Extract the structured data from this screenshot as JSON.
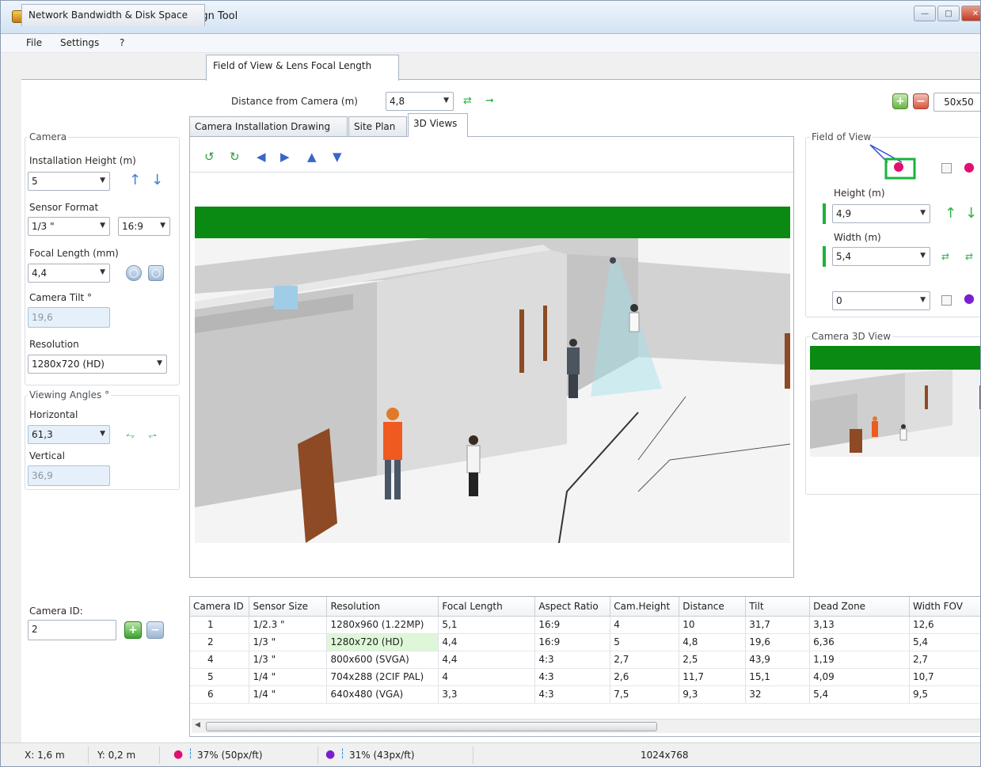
{
  "window": {
    "title": "cctv.jvsg* - IP Video System Design Tool"
  },
  "menu": [
    "File",
    "Settings",
    "?"
  ],
  "top_tabs": [
    "Network Bandwidth & Disk Space",
    "Field of View & Lens Focal Length"
  ],
  "distance": {
    "label": "Distance from Camera (m)",
    "value": "4,8"
  },
  "zoom_label": "50x50",
  "sub_tabs": [
    "Camera Installation Drawing",
    "Site Plan",
    "3D Views"
  ],
  "camera": {
    "group_label": "Camera",
    "installation_height_label": "Installation Height (m)",
    "installation_height": "5",
    "sensor_format_label": "Sensor Format",
    "sensor_format": "1/3 \"",
    "aspect": "16:9",
    "focal_length_label": "Focal Length (mm)",
    "focal_length": "4,4",
    "tilt_label": "Camera Tilt °",
    "tilt": "19,6",
    "resolution_label": "Resolution",
    "resolution": "1280x720 (HD)"
  },
  "viewing_angles": {
    "group_label": "Viewing Angles °",
    "horizontal_label": "Horizontal",
    "horizontal": "61,3",
    "vertical_label": "Vertical",
    "vertical": "36,9"
  },
  "field_of_view": {
    "group_label": "Field of View",
    "height_label": "Height (m)",
    "height": "4,9",
    "width_label": "Width (m)",
    "width": "5,4",
    "offset": "0"
  },
  "camera_3d_label": "Camera 3D View",
  "camera_id": {
    "label": "Camera ID:",
    "value": "2"
  },
  "table": {
    "columns": [
      "Camera ID",
      "Sensor Size",
      "Resolution",
      "Focal Length",
      "Aspect Ratio",
      "Cam.Height",
      "Distance",
      "Tilt",
      "Dead Zone",
      "Width FOV"
    ],
    "rows": [
      [
        "1",
        "1/2.3 \"",
        "1280x960 (1.22MP)",
        "5,1",
        "16:9",
        "4",
        "10",
        "31,7",
        "3,13",
        "12,6"
      ],
      [
        "2",
        "1/3 \"",
        "1280x720 (HD)",
        "4,4",
        "16:9",
        "5",
        "4,8",
        "19,6",
        "6,36",
        "5,4"
      ],
      [
        "4",
        "1/3 \"",
        "800x600 (SVGA)",
        "4,4",
        "4:3",
        "2,7",
        "2,5",
        "43,9",
        "1,19",
        "2,7"
      ],
      [
        "5",
        "1/4 \"",
        "704x288 (2CIF PAL)",
        "4",
        "4:3",
        "2,6",
        "11,7",
        "15,1",
        "4,09",
        "10,7"
      ],
      [
        "6",
        "1/4 \"",
        "640x480 (VGA)",
        "3,3",
        "4:3",
        "7,5",
        "9,3",
        "32",
        "5,4",
        "9,5"
      ]
    ]
  },
  "status": {
    "x": "X: 1,6 m",
    "y": "Y: 0,2 m",
    "red_pixels": "37% (50px/ft)",
    "purple_pixels": "31% (43px/ft)",
    "resolution": "1024x768"
  },
  "colors": {
    "accent_green": "#19b33a",
    "selection_green": "#def7d8",
    "scene_green": "#0a8a12"
  }
}
